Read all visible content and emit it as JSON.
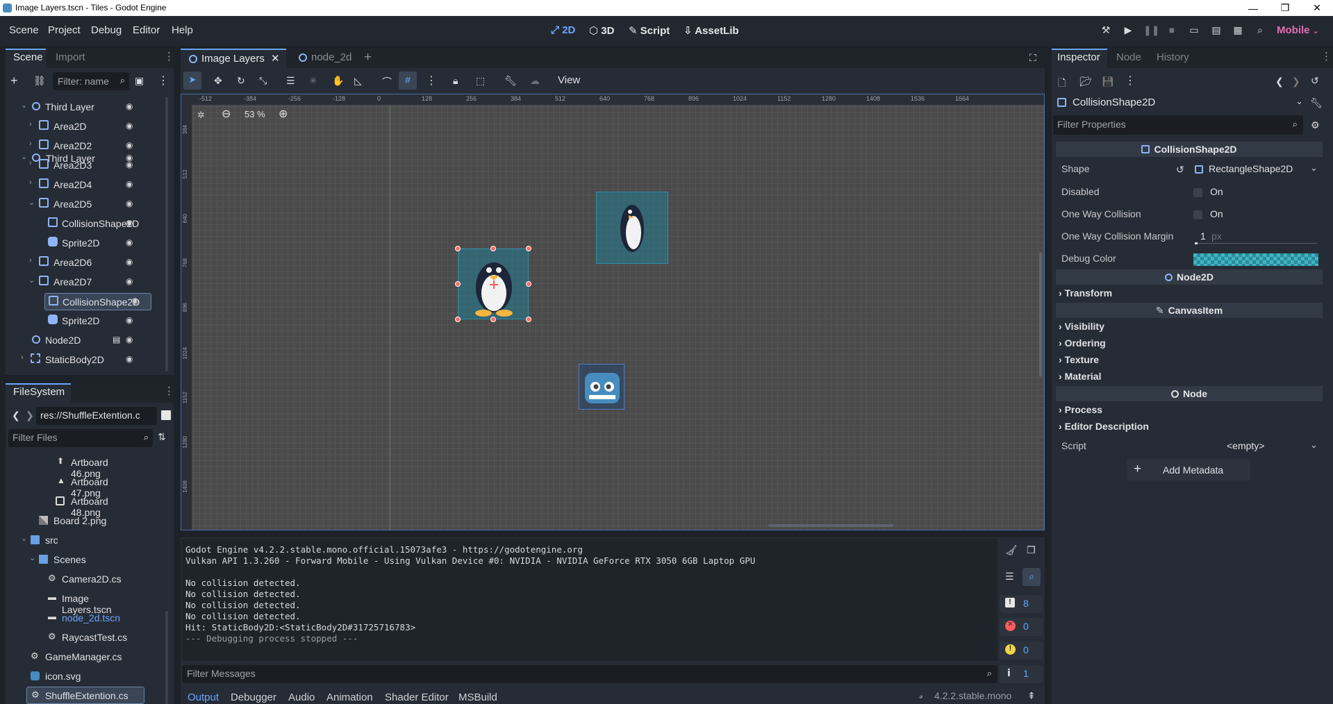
{
  "window": {
    "title": "Image Layers.tscn - Tiles - Godot Engine",
    "minimize": "—",
    "maximize": "❐",
    "close": "✕"
  },
  "menu": [
    "Scene",
    "Project",
    "Debug",
    "Editor",
    "Help"
  ],
  "workspaces": {
    "w2d": "2D",
    "w3d": "3D",
    "script": "Script",
    "assetlib": "AssetLib"
  },
  "renderer": "Mobile",
  "scene_dock": {
    "tabs": [
      "Scene",
      "Import"
    ],
    "filter_placeholder": "Filter: name",
    "items": [
      {
        "label": "Third Layer"
      },
      {
        "label": "Area2D"
      },
      {
        "label": "Area2D2"
      },
      {
        "label": "Area2D3"
      },
      {
        "label": "Area2D4"
      },
      {
        "label": "Area2D5"
      },
      {
        "label": "CollisionShape2D"
      },
      {
        "label": "Sprite2D"
      },
      {
        "label": "Area2D6"
      },
      {
        "label": "Area2D7"
      },
      {
        "label": "CollisionShape2D"
      },
      {
        "label": "Sprite2D"
      },
      {
        "label": "Node2D"
      },
      {
        "label": "StaticBody2D"
      }
    ]
  },
  "filesystem": {
    "tab": "FileSystem",
    "path": "res://ShuffleExtention.c",
    "filter_placeholder": "Filter Files",
    "items": [
      {
        "label": "Artboard 46.png"
      },
      {
        "label": "Artboard 47.png"
      },
      {
        "label": "Artboard 48.png"
      },
      {
        "label": "Board 2.png"
      },
      {
        "label": "src"
      },
      {
        "label": "Scenes"
      },
      {
        "label": "Camera2D.cs"
      },
      {
        "label": "Image Layers.tscn"
      },
      {
        "label": "node_2d.tscn"
      },
      {
        "label": "RaycastTest.cs"
      },
      {
        "label": "GameManager.cs"
      },
      {
        "label": "icon.svg"
      },
      {
        "label": "ShuffleExtention.cs"
      }
    ]
  },
  "editor_tabs": [
    "Image Layers",
    "node_2d"
  ],
  "toolbar": {
    "view": "View"
  },
  "viewport": {
    "zoom": "53 %",
    "ruler_h": [
      "-512",
      "-384",
      "-256",
      "-128",
      "0",
      "128",
      "256",
      "384",
      "512",
      "640",
      "768",
      "896",
      "1024",
      "1152",
      "1280",
      "1408",
      "1536",
      "1664"
    ],
    "ruler_v": [
      "384",
      "512",
      "640",
      "768",
      "896",
      "1024",
      "1152",
      "1280",
      "1408"
    ]
  },
  "output": {
    "lines": [
      "Godot Engine v4.2.2.stable.mono.official.15073afe3 - https://godotengine.org",
      "Vulkan API 1.3.260 - Forward Mobile - Using Vulkan Device #0: NVIDIA - NVIDIA GeForce RTX 3050 6GB Laptop GPU",
      "",
      "No collision detected.",
      "No collision detected.",
      "No collision detected.",
      "No collision detected.",
      "Hit: StaticBody2D:<StaticBody2D#31725716783>",
      "--- Debugging process stopped ---"
    ],
    "filter_placeholder": "Filter Messages",
    "counts": {
      "messages": "8",
      "errors": "0",
      "warnings": "0",
      "info": "1"
    }
  },
  "bottom_tabs": [
    "Output",
    "Debugger",
    "Audio",
    "Animation",
    "Shader Editor",
    "MSBuild"
  ],
  "version": "4.2.2.stable.mono",
  "inspector": {
    "tabs": [
      "Inspector",
      "Node",
      "History"
    ],
    "object": "CollisionShape2D",
    "filter_placeholder": "Filter Properties",
    "section_collision": "CollisionShape2D",
    "props": {
      "shape_label": "Shape",
      "shape_value": "RectangleShape2D",
      "disabled_label": "Disabled",
      "disabled_value": "On",
      "oneway_label": "One Way Collision",
      "oneway_value": "On",
      "margin_label": "One Way Collision Margin",
      "margin_value": "1",
      "margin_unit": "px",
      "debug_label": "Debug Color"
    },
    "section_node2d": "Node2D",
    "transform": "Transform",
    "section_canvas": "CanvasItem",
    "canvas_groups": [
      "Visibility",
      "Ordering",
      "Texture",
      "Material"
    ],
    "section_node": "Node",
    "node_groups": [
      "Process",
      "Editor Description"
    ],
    "script_label": "Script",
    "script_value": "<empty>",
    "add_metadata": "Add Metadata"
  },
  "colors": {
    "accent": "#6ba6ff",
    "renderer": "#e36fb4",
    "selection_handle": "#ff5c5c"
  }
}
